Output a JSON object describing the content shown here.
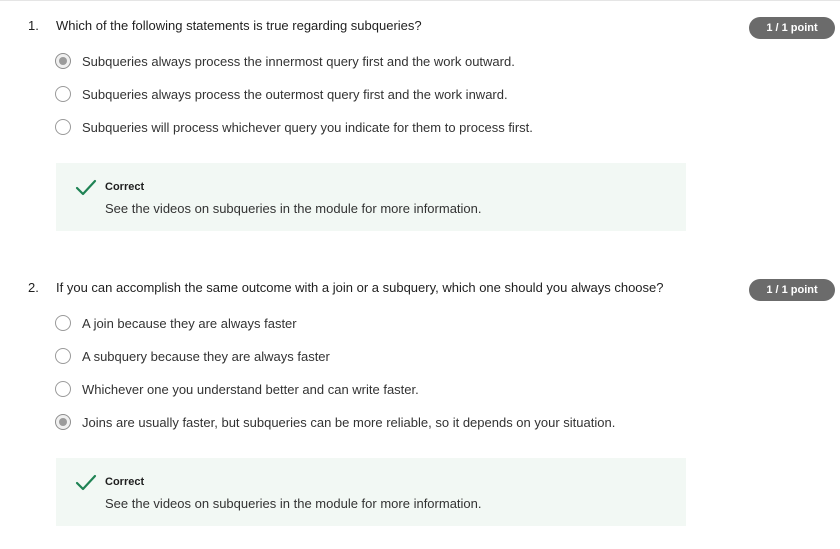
{
  "questions": [
    {
      "number": "1.",
      "text": "Which of the following statements is true regarding subqueries?",
      "score": "1 / 1 point",
      "options": [
        {
          "label": "Subqueries always process the innermost query first and the work outward.",
          "selected": true
        },
        {
          "label": "Subqueries always process the outermost query first and the work inward.",
          "selected": false
        },
        {
          "label": "Subqueries will process whichever query you indicate for them to process first.",
          "selected": false
        }
      ],
      "feedback": {
        "title": "Correct",
        "text": "See the videos on subqueries in the module for more information."
      }
    },
    {
      "number": "2.",
      "text": "If you can accomplish the same outcome with a join or a subquery, which one should you always choose?",
      "score": "1 / 1 point",
      "options": [
        {
          "label": "A join because they are always faster",
          "selected": false
        },
        {
          "label": "A subquery because they are always faster",
          "selected": false
        },
        {
          "label": "Whichever one you understand better and can write faster.",
          "selected": false
        },
        {
          "label": "Joins are usually faster, but subqueries can be more reliable, so it depends on your situation.",
          "selected": true
        }
      ],
      "feedback": {
        "title": "Correct",
        "text": "See the videos on subqueries in the module for more information."
      }
    }
  ],
  "colors": {
    "correct_check": "#1f8354",
    "feedback_bg": "#f2f8f4",
    "badge_bg": "#6b6b6b"
  },
  "icons": {
    "feedback": "check-icon",
    "option": "radio-icon"
  }
}
